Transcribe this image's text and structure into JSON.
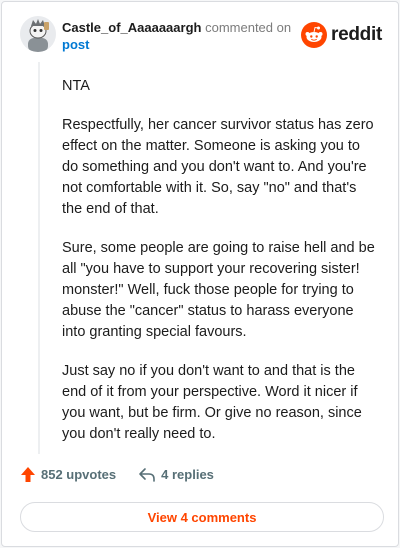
{
  "comment": {
    "author": "Castle_of_Aaaaaaargh",
    "action_text": "commented on",
    "post_link": "post",
    "paragraphs": [
      "NTA",
      "Respectfully, her cancer survivor status has zero effect on the matter. Someone is asking you to do something and you don't want to. And you're not comfortable with it. So, say \"no\" and that's the end of that.",
      "Sure, some people are going to raise hell and be all \"you have to support your recovering sister! monster!\" Well, fuck those people for trying to abuse the \"cancer\" status to harass everyone into granting special favours.",
      "Just say no if you don't want to and that is the end of it from your perspective. Word it nicer if you want, but be firm. Or give no reason, since you don't really need to."
    ],
    "upvotes": "852 upvotes",
    "replies": "4 replies"
  },
  "brand": {
    "name": "reddit",
    "color": "#ff4500"
  },
  "view_button": {
    "label": "View 4 comments"
  },
  "icons": {
    "avatar": "snoo-avatar",
    "logo": "reddit-snoo-icon",
    "upvote": "upvote-arrow-icon",
    "reply": "reply-arrow-icon"
  }
}
